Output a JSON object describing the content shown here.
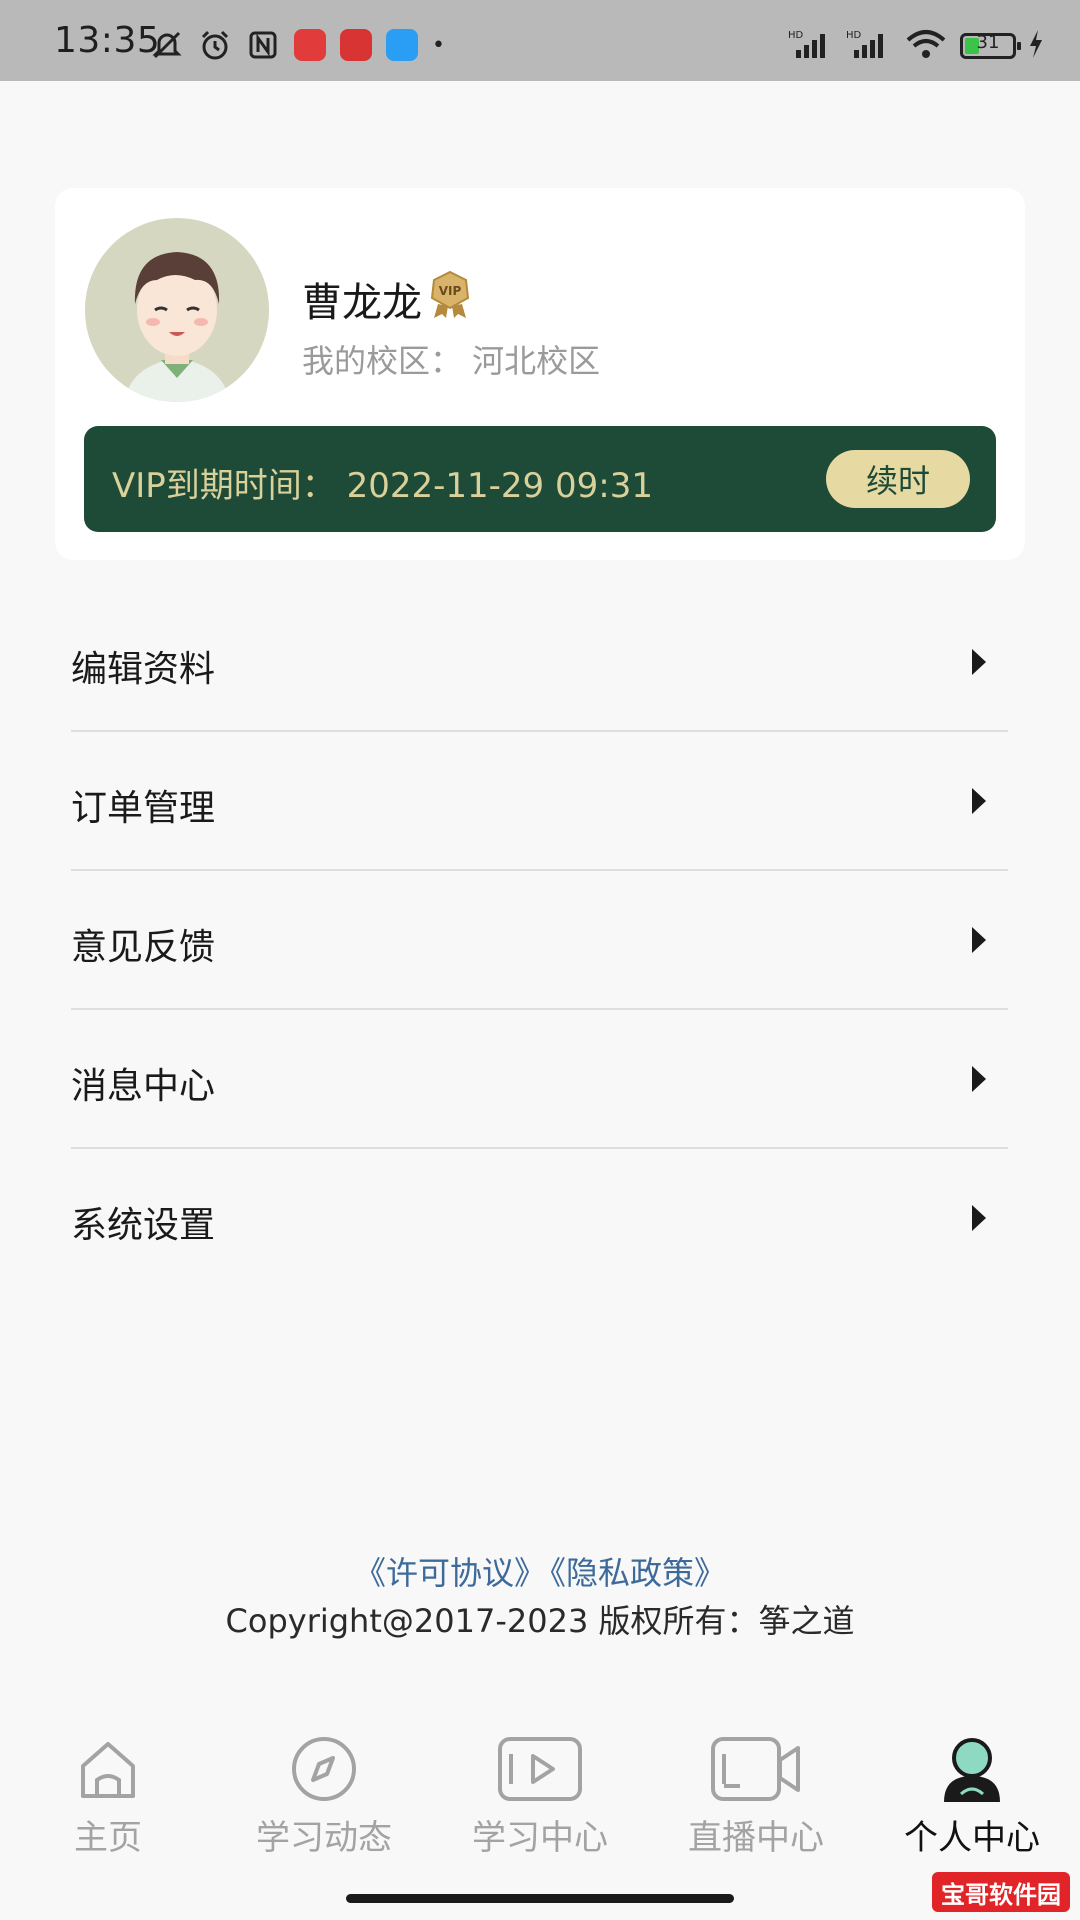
{
  "status_bar": {
    "time": "13:35",
    "battery": "31",
    "app_icons": [
      "mute-bell-icon",
      "alarm-icon",
      "nfc-icon",
      "app-baidu",
      "app-toutiao",
      "app-chat"
    ]
  },
  "profile": {
    "name": "曹龙龙",
    "vip_badge": "VIP",
    "campus": "我的校区：  河北校区",
    "vip_expiry": "VIP到期时间：  2022-11-29 09:31",
    "renew_label": "续时"
  },
  "menu": {
    "items": [
      {
        "label": "编辑资料"
      },
      {
        "label": "订单管理"
      },
      {
        "label": "意见反馈"
      },
      {
        "label": "消息中心"
      },
      {
        "label": "系统设置"
      }
    ]
  },
  "footer": {
    "license_link": "《许可协议》",
    "privacy_link": "《隐私政策》",
    "copyright": "Copyright@2017-2023 版权所有：筝之道"
  },
  "tabs": [
    {
      "label": "主页",
      "icon": "home-icon",
      "active": false
    },
    {
      "label": "学习动态",
      "icon": "compass-icon",
      "active": false
    },
    {
      "label": "学习中心",
      "icon": "play-icon",
      "active": false
    },
    {
      "label": "直播中心",
      "icon": "video-camera-icon",
      "active": false
    },
    {
      "label": "个人中心",
      "icon": "person-icon",
      "active": true
    }
  ],
  "watermark": "宝哥软件园",
  "colors": {
    "vip_bar": "#1e4a38",
    "vip_text": "#d9d09a",
    "renew_button": "#e6d9a2",
    "link": "#3e6a9a",
    "inactive_tab": "#a3a3a3"
  }
}
